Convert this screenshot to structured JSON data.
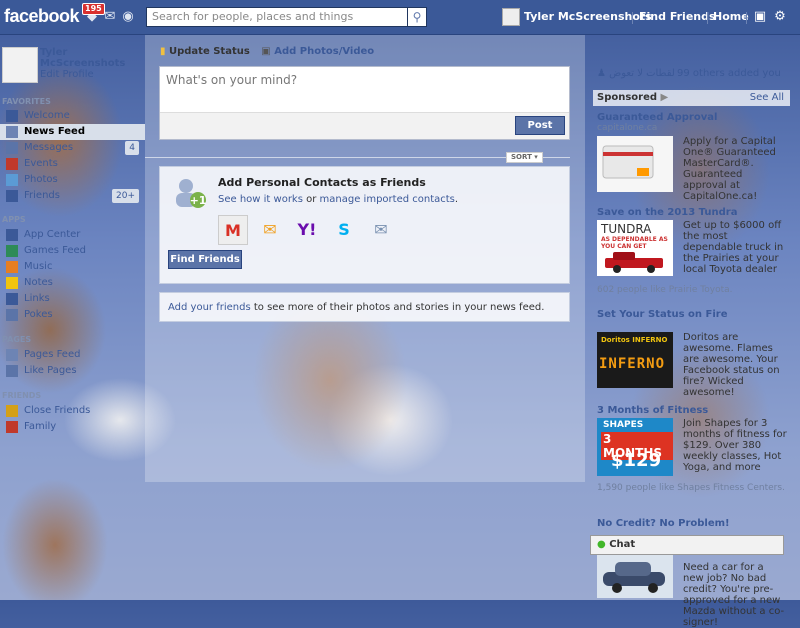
{
  "header": {
    "logo": "facebook",
    "notifications_badge": "195",
    "search_placeholder": "Search for people, places and things",
    "user_name": "Tyler McScreenshots",
    "find_friends": "Find Friends",
    "home": "Home"
  },
  "sidebar": {
    "profile_name": "Tyler McScreenshots",
    "edit_profile": "Edit Profile",
    "favorites_heading": "FAVORITES",
    "apps_heading": "APPS",
    "pages_heading": "PAGES",
    "friends_heading": "FRIENDS",
    "items": [
      {
        "label": "Welcome",
        "icon": "welcome-icon",
        "color": "#3b5998"
      },
      {
        "label": "News Feed",
        "icon": "news-feed-icon",
        "color": "#6d84b4"
      },
      {
        "label": "Messages",
        "icon": "messages-icon",
        "color": "#5b74a8",
        "count": "4"
      },
      {
        "label": "Events",
        "icon": "events-icon",
        "color": "#c0392b"
      },
      {
        "label": "Photos",
        "icon": "photos-icon",
        "color": "#5b9bd5"
      },
      {
        "label": "Friends",
        "icon": "friends-icon",
        "color": "#3b5998",
        "count": "20+"
      }
    ],
    "apps": [
      {
        "label": "App Center",
        "icon": "app-center-icon",
        "color": "#3b5998"
      },
      {
        "label": "Games Feed",
        "icon": "games-feed-icon",
        "color": "#2e8b57"
      },
      {
        "label": "Music",
        "icon": "music-icon",
        "color": "#e67e22"
      },
      {
        "label": "Notes",
        "icon": "notes-icon",
        "color": "#f1c40f"
      },
      {
        "label": "Links",
        "icon": "links-icon",
        "color": "#3b5998"
      },
      {
        "label": "Pokes",
        "icon": "pokes-icon",
        "color": "#5b74a8"
      }
    ],
    "pages": [
      {
        "label": "Pages Feed",
        "icon": "pages-feed-icon",
        "color": "#6d84b4"
      },
      {
        "label": "Like Pages",
        "icon": "like-pages-icon",
        "color": "#5b74a8"
      }
    ],
    "friends": [
      {
        "label": "Close Friends",
        "icon": "close-friends-icon",
        "color": "#d4a017"
      },
      {
        "label": "Family",
        "icon": "family-icon",
        "color": "#c0392b"
      }
    ]
  },
  "composer": {
    "update_status": "Update Status",
    "add_photos": "Add Photos/Video",
    "placeholder": "What's on your mind?",
    "post_button": "Post"
  },
  "sort": {
    "label": "SORT ▾"
  },
  "contacts_card": {
    "title": "Add Personal Contacts as Friends",
    "see_how": "See how it works",
    "or": " or ",
    "manage": "manage imported contacts",
    "period": ".",
    "find_friends": "Find Friends",
    "providers": [
      {
        "name": "gmail-icon",
        "glyph": "M",
        "color": "#d93025"
      },
      {
        "name": "hotmail-icon",
        "glyph": "✉",
        "color": "#f0a020"
      },
      {
        "name": "yahoo-icon",
        "glyph": "Y!",
        "color": "#6a0dad"
      },
      {
        "name": "skype-icon",
        "glyph": "S",
        "color": "#00aff0"
      },
      {
        "name": "email-icon",
        "glyph": "✉",
        "color": "#7890b0"
      }
    ]
  },
  "add_friends_bar": {
    "link": "Add your friends",
    "text": " to see more of their photos and stories in your news feed."
  },
  "right": {
    "page_name": "لقطات لا تعوض",
    "others_added": "99 others added you",
    "sponsored": "Sponsored",
    "see_all": "See All",
    "ads": [
      {
        "title": "Guaranteed Approval",
        "domain": "capitalone.ca",
        "body": "Apply for a Capital One® Guaranteed MasterCard®. Guaranteed approval at CapitalOne.ca!",
        "foot": ""
      },
      {
        "title": "Save on the 2013 Tundra",
        "domain": "",
        "body": "Get up to $6000 off the most dependable truck in the Prairies at your local Toyota dealer",
        "foot": "602 people like Prairie Toyota."
      },
      {
        "title": "Set Your Status on Fire",
        "domain": "",
        "body": "Doritos are awesome. Flames are awesome. Your Facebook status on fire? Wicked awesome!",
        "foot": ""
      },
      {
        "title": "3 Months of Fitness",
        "domain": "",
        "body": "Join Shapes for 3 months of fitness for $129. Over 380 weekly classes, Hot Yoga, and more",
        "foot": "1,590 people like Shapes Fitness Centers."
      },
      {
        "title": "No Credit? No Problem!",
        "domain": "",
        "body": "Need a car for a new job? No bad credit? You're pre-approved for a new Mazda without a co-signer!",
        "foot": ""
      }
    ],
    "ad_images": {
      "tundra_text": "TUNDRA",
      "tundra_tag": "AS DEPENDABLE AS YOU CAN GET",
      "doritos_text": "INFERNO",
      "doritos_brand": "Doritos INFERNO",
      "shapes_brand": "SHAPES",
      "shapes_months": "3 MONTHS",
      "shapes_price": "$129"
    }
  },
  "chat": {
    "label": "Chat"
  }
}
